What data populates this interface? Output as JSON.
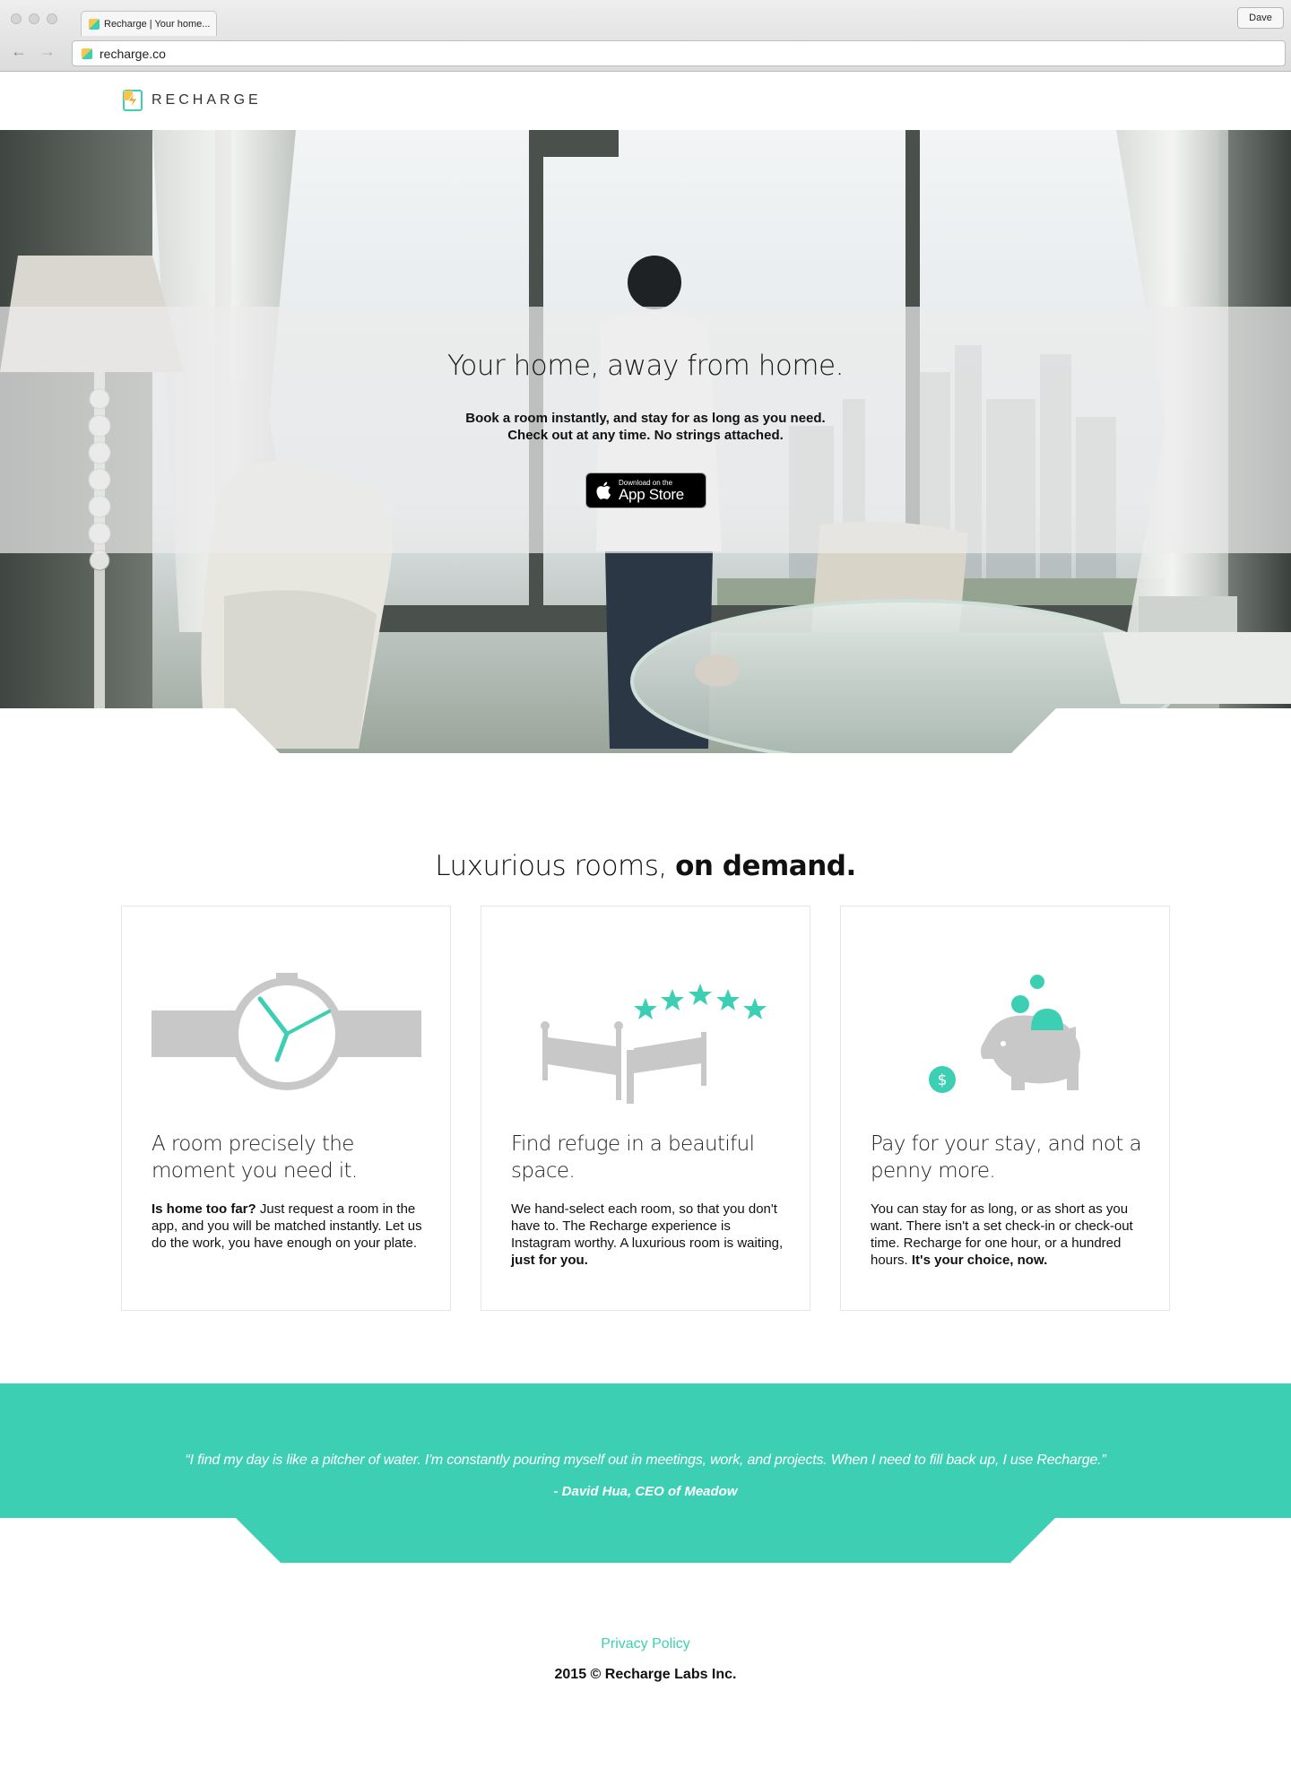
{
  "browser": {
    "tab_title": "Recharge | Your home...",
    "url": "recharge.co",
    "profile": "Dave",
    "icons": [
      "back-arrow-icon",
      "forward-arrow-icon",
      "favicon-icon"
    ]
  },
  "header": {
    "brand": "RECHARGE"
  },
  "hero": {
    "title": "Your home, away from home.",
    "subtitle_line1": "Book a room instantly, and stay for as long as you need.",
    "subtitle_line2": "Check out at any time. No strings attached.",
    "appstore_small": "Download on the",
    "appstore_big": "App Store"
  },
  "features": {
    "title_light": "Luxurious rooms,",
    "title_bold": "on demand.",
    "cards": [
      {
        "title": "A room precisely the moment you need it.",
        "body_bold": "Is home too far?",
        "body": " Just request a room in the app, and you will be matched instantly. Let us do the work, you have enough on your plate.",
        "body_end": "",
        "icon": "watch-icon"
      },
      {
        "title": "Find refuge in a beautiful space.",
        "body_bold": "",
        "body": "We hand-select each room, so that you don't have to. The Recharge experience is Instagram worthy. A luxurious room is waiting,",
        "body_end": " just for you.",
        "icon": "bed-stars-icon"
      },
      {
        "title": "Pay for your stay, and not a penny more.",
        "body_bold": "",
        "body": "You can stay for as long, or as short as you want. There isn't a set check-in or check-out time. Recharge for one hour, or a hundred hours.",
        "body_end": " It's your choice, now.",
        "icon": "piggy-bank-icon"
      }
    ]
  },
  "testimonial": {
    "quote": "“I find my day is like a pitcher of water. I'm constantly pouring myself out in meetings, work, and projects. When I need to fill back up, I use Recharge.”",
    "author": "- David Hua, CEO of Meadow"
  },
  "footer": {
    "privacy": "Privacy Policy",
    "copyright": "2015 © Recharge Labs Inc."
  },
  "colors": {
    "accent": "#3ccfb3",
    "icon_gray": "#c8c8c8",
    "text": "#111111"
  }
}
